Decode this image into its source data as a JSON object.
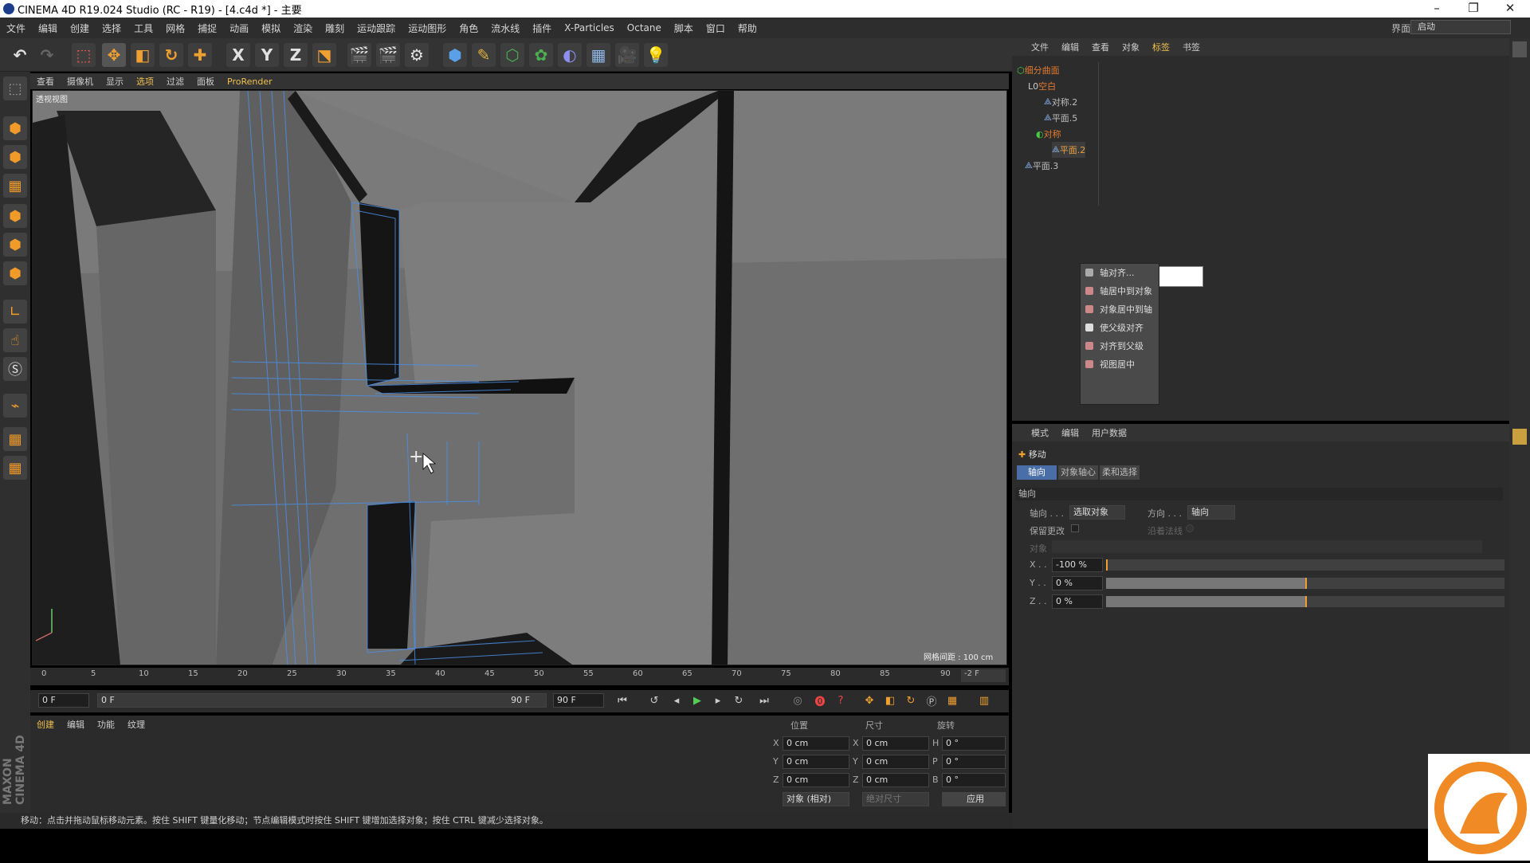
{
  "window": {
    "title": "CINEMA 4D R19.024 Studio (RC - R19) - [4.c4d *] - 主要",
    "min": "–",
    "max": "❐",
    "close": "✕"
  },
  "menu": [
    "文件",
    "编辑",
    "创建",
    "选择",
    "工具",
    "网格",
    "捕捉",
    "动画",
    "模拟",
    "渲染",
    "雕刻",
    "运动跟踪",
    "运动图形",
    "角色",
    "流水线",
    "插件",
    "X-Particles",
    "Octane",
    "脚本",
    "窗口",
    "帮助"
  ],
  "interface": {
    "label": "界面:",
    "value": "启动"
  },
  "toolbar": {
    "x": "X",
    "y": "Y",
    "z": "Z"
  },
  "viewport": {
    "menu": [
      "查看",
      "摄像机",
      "显示",
      "选项",
      "过滤",
      "面板",
      "ProRender"
    ],
    "name": "透视视图",
    "grid_label": "网格间距 : 100 cm"
  },
  "timeline": {
    "ticks": [
      "0",
      "5",
      "10",
      "15",
      "20",
      "25",
      "30",
      "35",
      "40",
      "45",
      "50",
      "55",
      "60",
      "65",
      "70",
      "75",
      "80",
      "85",
      "90"
    ],
    "end_frame": "-2 F"
  },
  "transport": {
    "start": "0 F",
    "range_start": "0 F",
    "range_end": "90 F",
    "end": "90 F"
  },
  "material_panel": {
    "tabs": [
      "创建",
      "编辑",
      "功能",
      "纹理"
    ]
  },
  "coords": {
    "headers": [
      "位置",
      "尺寸",
      "旋转"
    ],
    "rows": [
      {
        "axis": "X",
        "pos": "0 cm",
        "size_axis": "X",
        "size": "0 cm",
        "rot_axis": "H",
        "rot": "0 °"
      },
      {
        "axis": "Y",
        "pos": "0 cm",
        "size_axis": "Y",
        "size": "0 cm",
        "rot_axis": "P",
        "rot": "0 °"
      },
      {
        "axis": "Z",
        "pos": "0 cm",
        "size_axis": "Z",
        "size": "0 cm",
        "rot_axis": "B",
        "rot": "0 °"
      }
    ],
    "mode": "对象 (相对)",
    "size_mode": "绝对尺寸",
    "apply": "应用"
  },
  "status": "移动：点击并拖动鼠标移动元素。按住 SHIFT 键量化移动；节点编辑模式时按住 SHIFT 键增加选择对象；按住 CTRL 键减少选择对象。",
  "object_manager": {
    "menu": [
      "文件",
      "编辑",
      "查看",
      "对象",
      "标签",
      "书签"
    ],
    "objects": [
      {
        "name": "细分曲面",
        "depth": 0,
        "color": "#e07a30"
      },
      {
        "name": "空白",
        "depth": 1,
        "color": "#e07a30"
      },
      {
        "name": "对称.2",
        "depth": 2,
        "color": "#cfcfcf"
      },
      {
        "name": "平面.5",
        "depth": 2,
        "color": "#cfcfcf"
      },
      {
        "name": "对称",
        "depth": 2,
        "color": "#e07a30"
      },
      {
        "name": "平面.2",
        "depth": 3,
        "color": "#e8a040"
      },
      {
        "name": "平面.3",
        "depth": 0,
        "color": "#cfcfcf"
      }
    ]
  },
  "context_menu": [
    "轴对齐...",
    "轴居中到对象",
    "对象居中到轴",
    "使父级对齐",
    "对齐到父级",
    "视图居中"
  ],
  "attr_manager": {
    "menu": [
      "模式",
      "编辑",
      "用户数据"
    ],
    "tool": "移动",
    "tabs": [
      "轴向",
      "对象轴心",
      "柔和选择"
    ],
    "section": "轴向",
    "axis_label": "轴向 . . .",
    "axis_value": "选取对象",
    "dir_label": "方向 . . .",
    "dir_value": "轴向",
    "keep_label": "保留更改",
    "along_normal": "沿着法线",
    "object_label": "对象",
    "x_label": "X . .",
    "x_value": "-100 %",
    "y_label": "Y . .",
    "y_value": "0 %",
    "z_label": "Z . .",
    "z_value": "0 %"
  },
  "branding": "MAXON CINEMA 4D"
}
